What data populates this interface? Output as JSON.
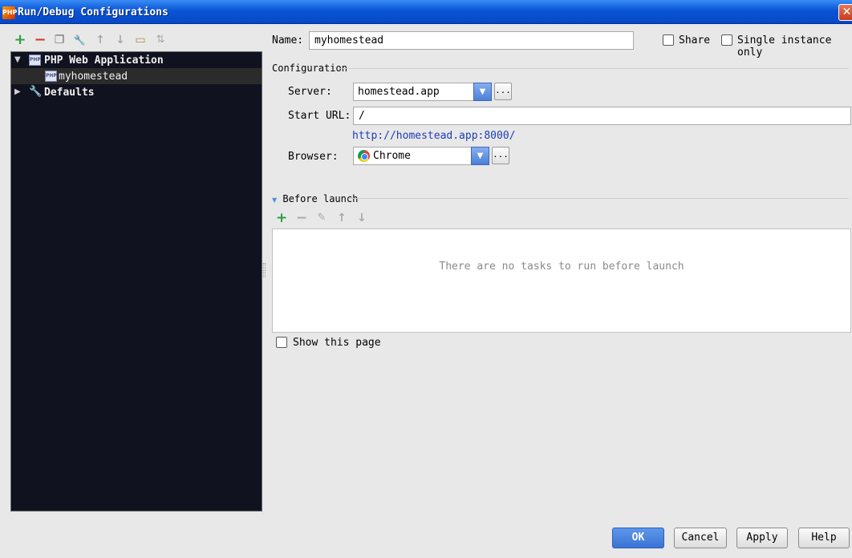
{
  "window": {
    "title": "Run/Debug Configurations",
    "app_icon_text": "PHP",
    "close_glyph": "✕"
  },
  "toolbar": {
    "items": [
      {
        "name": "add",
        "glyph": "+",
        "color": "#2e9e3e"
      },
      {
        "name": "remove",
        "glyph": "−",
        "color": "#d0372a"
      },
      {
        "name": "copy",
        "glyph": "❐",
        "color": "#6d6d6d"
      },
      {
        "name": "edit-defaults",
        "glyph": "🔧",
        "color": "#b07a2a"
      },
      {
        "name": "move-up",
        "glyph": "↑",
        "color": "#a8a8a8"
      },
      {
        "name": "move-down",
        "glyph": "↓",
        "color": "#a8a8a8"
      },
      {
        "name": "folder",
        "glyph": "▭",
        "color": "#b08a3a"
      },
      {
        "name": "sort",
        "glyph": "⇅",
        "color": "#a8a8a8"
      }
    ]
  },
  "tree": {
    "nodes": [
      {
        "label": "PHP Web Application",
        "expanded": true,
        "icon": "php-icon"
      },
      {
        "label": "myhomestead",
        "selected": true,
        "icon": "php-icon"
      },
      {
        "label": "Defaults",
        "expanded": false,
        "icon": "wrench-icon"
      }
    ]
  },
  "form": {
    "name_label": "Name:",
    "name_value": "myhomestead",
    "share_label": "Share",
    "single_instance_label": "Single instance only",
    "configuration_header": "Configuration",
    "server_label": "Server:",
    "server_value": "homestead.app",
    "start_url_label": "Start URL:",
    "start_url_value": "/",
    "resolved_url": "http://homestead.app:8000/",
    "browser_label": "Browser:",
    "browser_value": "Chrome",
    "dots": "..."
  },
  "before_launch": {
    "header": "Before launch",
    "empty_message": "There are no tasks to run before launch",
    "show_this_page_label": "Show this page",
    "tools": [
      {
        "name": "add",
        "glyph": "+",
        "color": "#2e9e3e"
      },
      {
        "name": "remove",
        "glyph": "−",
        "color": "#a8a8a8"
      },
      {
        "name": "edit",
        "glyph": "✎",
        "color": "#a8a8a8"
      },
      {
        "name": "move-up",
        "glyph": "↑",
        "color": "#a8a8a8"
      },
      {
        "name": "move-down",
        "glyph": "↓",
        "color": "#a8a8a8"
      }
    ]
  },
  "buttons": {
    "ok": "OK",
    "cancel": "Cancel",
    "apply": "Apply",
    "help": "Help"
  }
}
